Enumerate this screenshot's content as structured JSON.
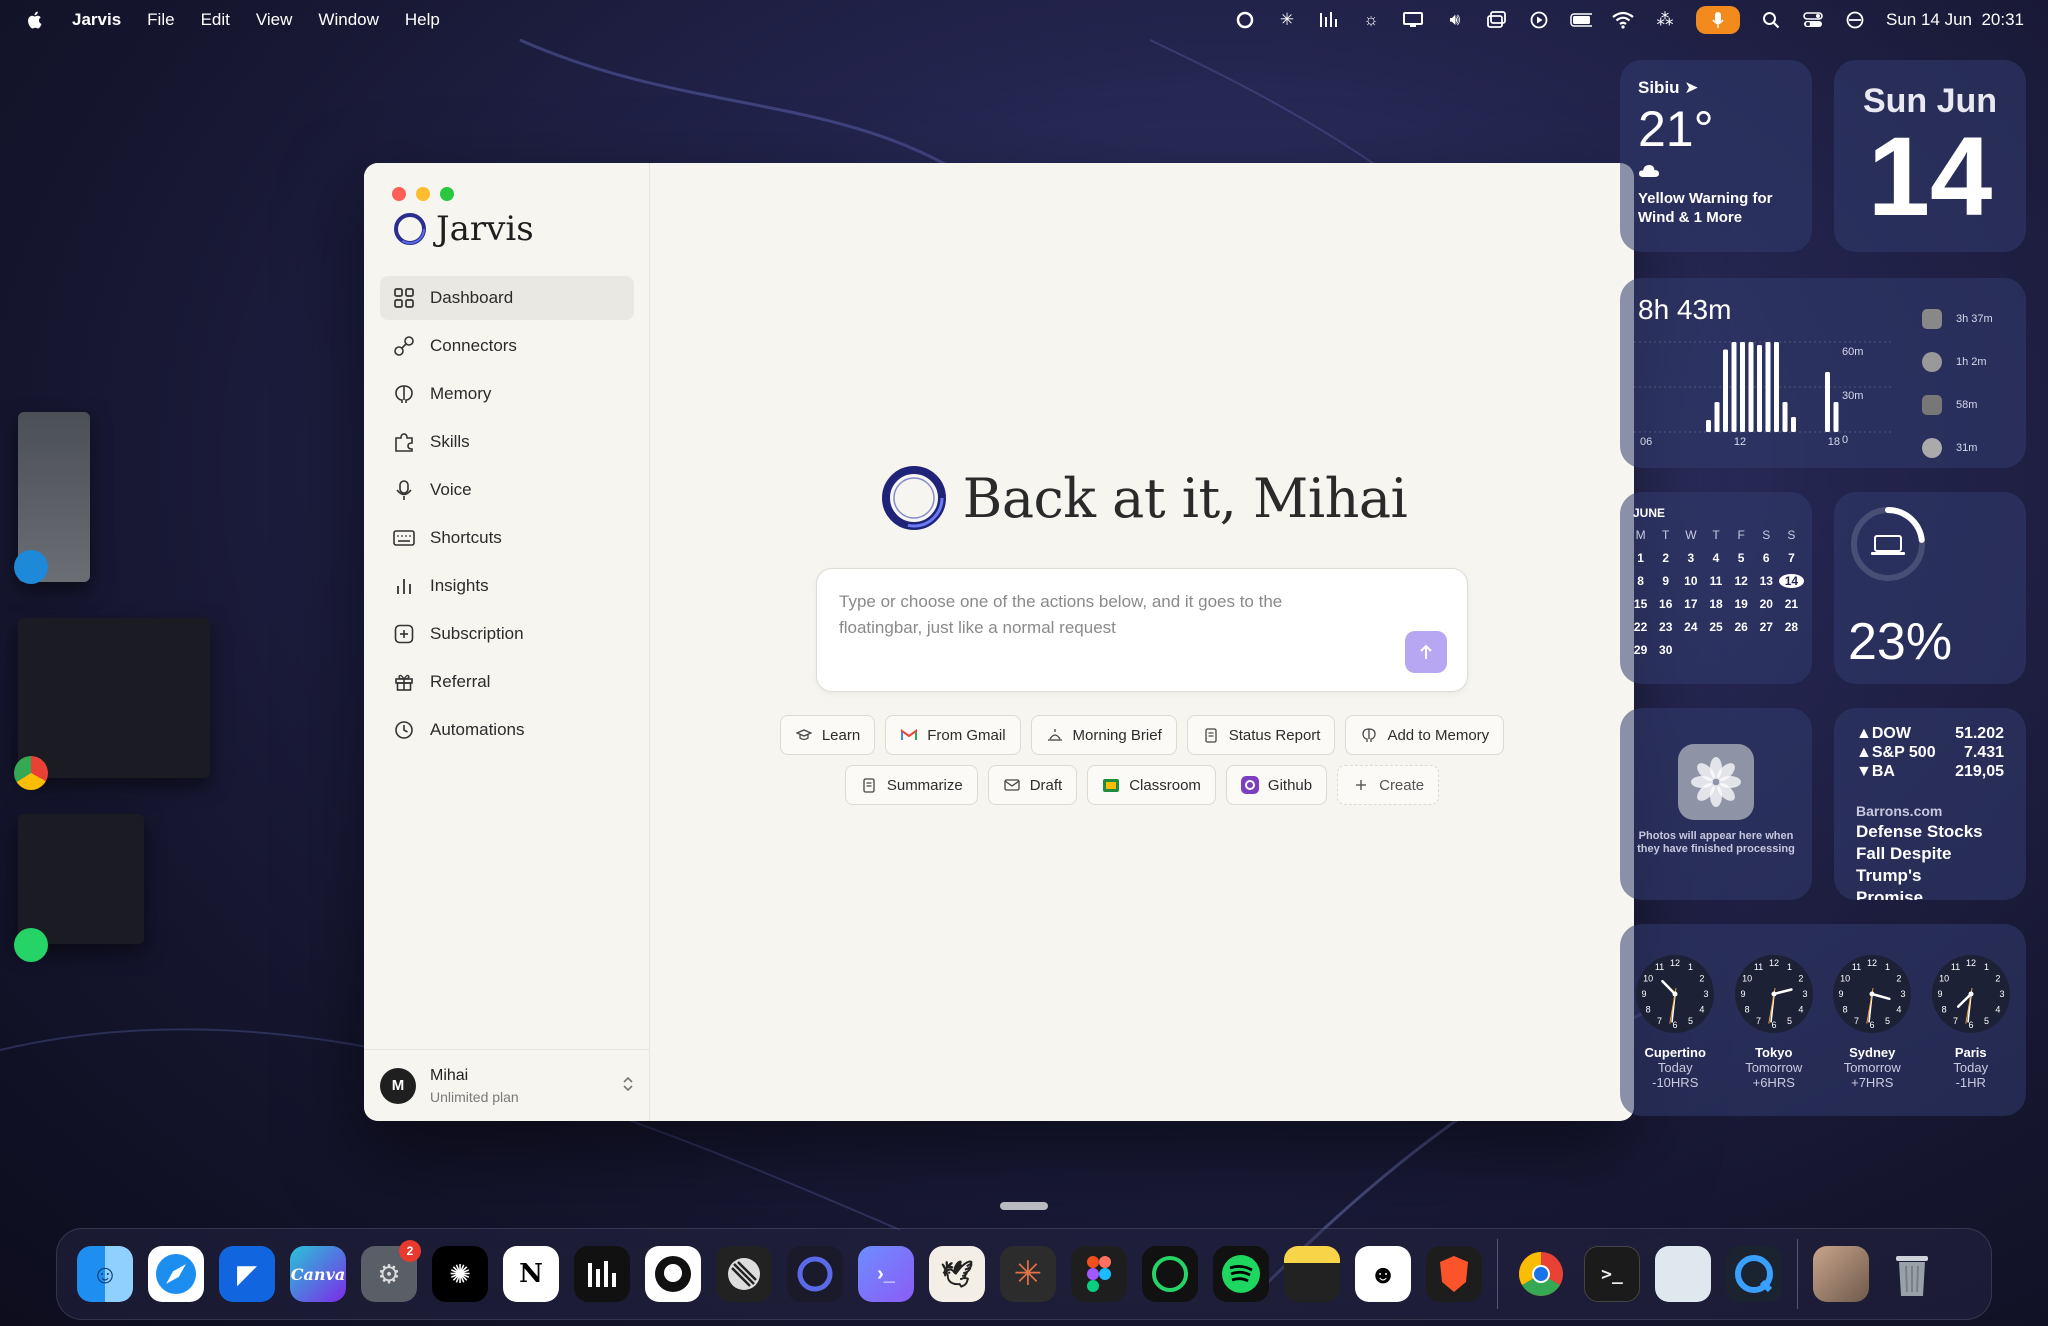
{
  "menubar": {
    "app_name": "Jarvis",
    "menus": [
      "File",
      "Edit",
      "View",
      "Window",
      "Help"
    ],
    "datetime": "Sun 14 Jun  20:31"
  },
  "app": {
    "brand": "Jarvis",
    "nav": [
      {
        "label": "Dashboard",
        "icon": "dashboard-grid-icon",
        "active": true
      },
      {
        "label": "Connectors",
        "icon": "plug-icon"
      },
      {
        "label": "Memory",
        "icon": "brain-icon"
      },
      {
        "label": "Skills",
        "icon": "puzzle-icon"
      },
      {
        "label": "Voice",
        "icon": "microphone-icon"
      },
      {
        "label": "Shortcuts",
        "icon": "keyboard-icon"
      },
      {
        "label": "Insights",
        "icon": "bar-chart-icon"
      },
      {
        "label": "Subscription",
        "icon": "plus-square-icon"
      },
      {
        "label": "Referral",
        "icon": "gift-icon"
      },
      {
        "label": "Automations",
        "icon": "clock-icon"
      }
    ],
    "user": {
      "initial": "M",
      "name": "Mihai",
      "plan": "Unlimited plan"
    },
    "greeting": "Back at it, Mihai",
    "prompt_placeholder": "Type or choose one of the actions below, and it goes to the floatingbar, just like a normal request",
    "actions_row1": [
      {
        "label": "Learn",
        "icon": "graduation-cap-icon"
      },
      {
        "label": "From Gmail",
        "icon": "gmail-icon"
      },
      {
        "label": "Morning Brief",
        "icon": "sunrise-icon"
      },
      {
        "label": "Status Report",
        "icon": "document-icon"
      },
      {
        "label": "Add to Memory",
        "icon": "brain-icon"
      }
    ],
    "actions_row2": [
      {
        "label": "Summarize",
        "icon": "document-icon"
      },
      {
        "label": "Draft",
        "icon": "envelope-icon"
      },
      {
        "label": "Classroom",
        "icon": "classroom-icon"
      },
      {
        "label": "Github",
        "icon": "github-icon"
      },
      {
        "label": "Create",
        "icon": "plus-icon"
      }
    ]
  },
  "widgets": {
    "weather": {
      "city": "Sibiu",
      "temp": "21°",
      "warning": "Yellow Warning for Wind & 1 More"
    },
    "date": {
      "dow": "Sun Jun",
      "day": "14"
    },
    "screen_time": {
      "total": "8h 43m",
      "x_ticks": [
        "06",
        "12",
        "18"
      ],
      "y_ticks": [
        "60m",
        "30m",
        "0"
      ],
      "apps": [
        "3h 37m",
        "1h 2m",
        "58m",
        "31m"
      ],
      "bars_minutes": [
        0,
        0,
        0,
        0,
        0,
        0,
        0,
        0,
        8,
        20,
        55,
        60,
        60,
        60,
        58,
        60,
        60,
        20,
        10,
        0,
        0,
        0,
        40,
        20
      ]
    },
    "calendar": {
      "month": "JUNE",
      "headers": [
        "M",
        "T",
        "W",
        "T",
        "F",
        "S",
        "S"
      ],
      "days": [
        "1",
        "2",
        "3",
        "4",
        "5",
        "6",
        "7",
        "8",
        "9",
        "10",
        "11",
        "12",
        "13",
        "14",
        "15",
        "16",
        "17",
        "18",
        "19",
        "20",
        "21",
        "22",
        "23",
        "24",
        "25",
        "26",
        "27",
        "28",
        "29",
        "30"
      ],
      "today": "14"
    },
    "battery": {
      "percent": "23%",
      "level": 0.23
    },
    "photos": {
      "message": "Photos will appear here when they have finished processing"
    },
    "stocks": {
      "rows": [
        {
          "dir": "▲",
          "name": "DOW",
          "value": "51.202"
        },
        {
          "dir": "▲",
          "name": "S&P 500",
          "value": "7.431"
        },
        {
          "dir": "▼",
          "name": "BA",
          "value": "219,05"
        }
      ],
      "source": "Barrons.com",
      "headline": "Defense Stocks Fall Despite Trump's Promise..."
    },
    "clocks": [
      {
        "city": "Cupertino",
        "day": "Today",
        "offset": "-10HRS",
        "hour": 10,
        "minute": 31
      },
      {
        "city": "Tokyo",
        "day": "Tomorrow",
        "offset": "+6HRS",
        "hour": 2,
        "minute": 31
      },
      {
        "city": "Sydney",
        "day": "Tomorrow",
        "offset": "+7HRS",
        "hour": 3,
        "minute": 31
      },
      {
        "city": "Paris",
        "day": "Today",
        "offset": "-1HR",
        "hour": 7,
        "minute": 31
      }
    ]
  },
  "dock": {
    "settings_badge": "2",
    "apps": [
      "Finder",
      "Safari",
      "Framer",
      "Canva",
      "System Settings",
      "ChatGPT",
      "Notion",
      "Analytics",
      "GitHub",
      "Linear",
      "Jarvis",
      "Remote",
      "Cardhop",
      "Claude",
      "Figma",
      "WhatsApp",
      "Spotify",
      "Notes",
      "Persona",
      "Brave",
      "Chrome",
      "Terminal",
      "Preview",
      "QuickTime",
      "Photo",
      "Trash"
    ]
  }
}
